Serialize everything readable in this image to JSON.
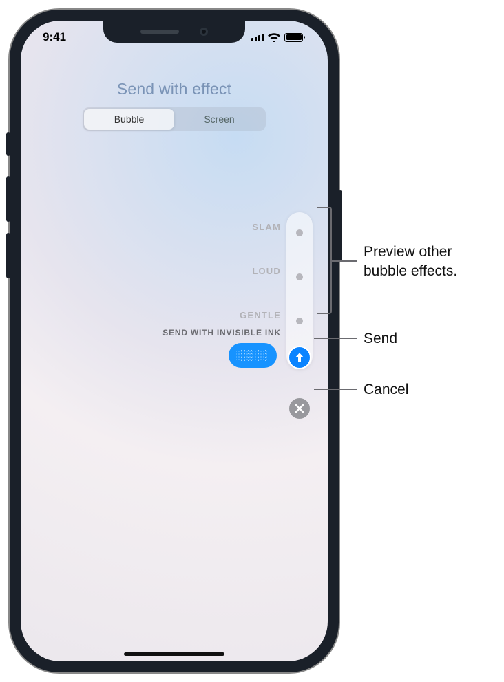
{
  "status": {
    "time": "9:41"
  },
  "header": {
    "title": "Send with effect"
  },
  "segmented": {
    "tabs": [
      {
        "label": "Bubble",
        "active": true
      },
      {
        "label": "Screen",
        "active": false
      }
    ]
  },
  "effects": {
    "options": [
      {
        "id": "slam",
        "label": "SLAM"
      },
      {
        "id": "loud",
        "label": "LOUD"
      },
      {
        "id": "gentle",
        "label": "GENTLE"
      }
    ],
    "selected_label": "SEND WITH INVISIBLE INK"
  },
  "callouts": {
    "preview": "Preview other bubble effects.",
    "send": "Send",
    "cancel": "Cancel"
  }
}
